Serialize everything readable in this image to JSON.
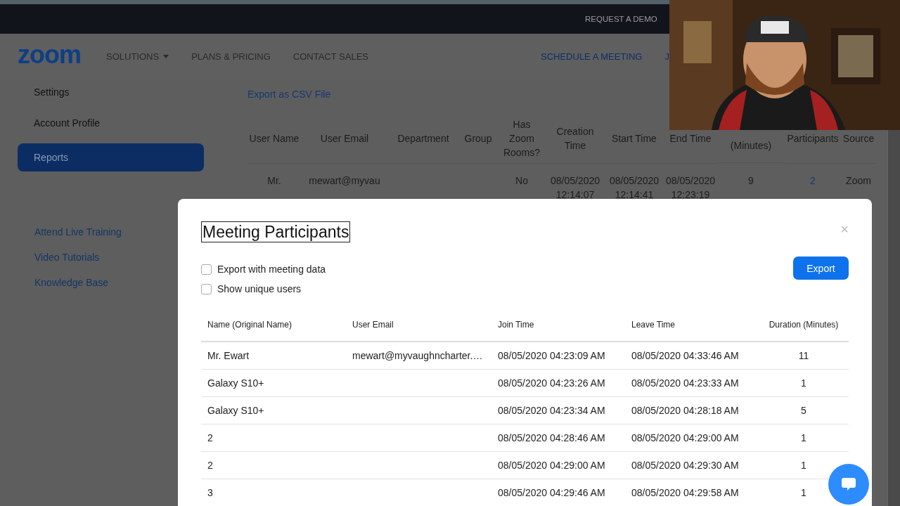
{
  "top_bar": {
    "link": "REQUEST A DEMO"
  },
  "nav": {
    "logo": "zoom",
    "items": [
      {
        "label": "SOLUTIONS",
        "kind": "dropdown"
      },
      {
        "label": "PLANS & PRICING",
        "kind": "link"
      },
      {
        "label": "CONTACT SALES",
        "kind": "link"
      }
    ],
    "right_items": [
      "SCHEDULE A MEETING",
      "J"
    ]
  },
  "sidebar": {
    "items": [
      {
        "label": "Settings",
        "selected": false
      },
      {
        "label": "Account Profile",
        "selected": false
      },
      {
        "label": "Reports",
        "selected": true
      }
    ],
    "help_links": [
      "Attend Live Training",
      "Video Tutorials",
      "Knowledge Base"
    ]
  },
  "report": {
    "export_link": "Export as CSV File",
    "columns": [
      "User Name",
      "User Email",
      "Department",
      "Group",
      "Has Zoom Rooms?",
      "Creation Time",
      "Start Time",
      "End Time",
      "(Minutes)",
      "Participants",
      "Source"
    ],
    "rows": [
      {
        "cells": [
          "Mr.",
          "mewart@myvau",
          null,
          null,
          "No",
          "08/05/2020 12:14:07",
          "08/05/2020 12:14:41",
          "08/05/2020 12:23:19",
          "9",
          "2",
          "Zoom"
        ]
      }
    ]
  },
  "dialog": {
    "title": "Meeting Participants",
    "close": "×",
    "checkboxes": [
      {
        "label": "Export with meeting data",
        "checked": false
      },
      {
        "label": "Show unique users",
        "checked": false
      }
    ],
    "export_button": "Export",
    "columns": [
      "Name (Original Name)",
      "User Email",
      "Join Time",
      "Leave Time",
      "Duration (Minutes)"
    ],
    "rows": [
      [
        "Mr. Ewart",
        "mewart@myvaughncharter.…",
        "08/05/2020 04:23:09 AM",
        "08/05/2020 04:33:46 AM",
        "11"
      ],
      [
        "Galaxy S10+",
        null,
        "08/05/2020 04:23:26 AM",
        "08/05/2020 04:23:33 AM",
        "1"
      ],
      [
        "Galaxy S10+",
        null,
        "08/05/2020 04:23:34 AM",
        "08/05/2020 04:28:18 AM",
        "5"
      ],
      [
        "2",
        null,
        "08/05/2020 04:28:46 AM",
        "08/05/2020 04:29:00 AM",
        "1"
      ],
      [
        "2",
        null,
        "08/05/2020 04:29:00 AM",
        "08/05/2020 04:29:30 AM",
        "1"
      ],
      [
        "3",
        null,
        "08/05/2020 04:29:46 AM",
        "08/05/2020 04:29:58 AM",
        "1"
      ]
    ]
  }
}
